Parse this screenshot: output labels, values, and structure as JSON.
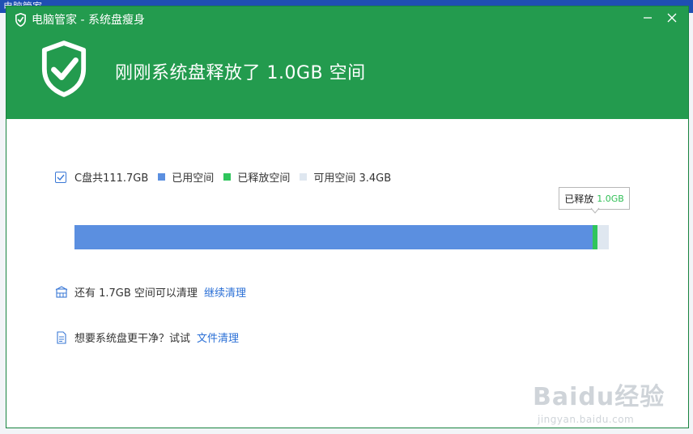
{
  "background": {
    "app_title": "电脑管家"
  },
  "window": {
    "title": "电脑管家 - 系统盘瘦身",
    "headline": "刚刚系统盘释放了 1.0GB 空间"
  },
  "disk": {
    "summary": "C盘共111.7GB",
    "legend": {
      "used_label": "已用空间",
      "freed_label": "已释放空间",
      "available_label": "可用空间 3.4GB"
    },
    "tooltip": {
      "label": "已释放",
      "value": "1.0GB"
    },
    "bar": {
      "used_fraction": 0.969,
      "freed_fraction": 0.009,
      "colors": {
        "used": "#5b8fe0",
        "freed": "#2fc55c",
        "available": "#dfe7f0"
      }
    }
  },
  "rows": [
    {
      "text": "还有 1.7GB 空间可以清理",
      "link": "继续清理"
    },
    {
      "text": "想要系统盘更干净？试试",
      "link": "文件清理"
    }
  ],
  "watermark": {
    "main": "Baidu经验",
    "sub": "jingyan.baidu.com"
  },
  "colors": {
    "header_green": "#239b4e",
    "link_blue": "#2a6fd6"
  }
}
